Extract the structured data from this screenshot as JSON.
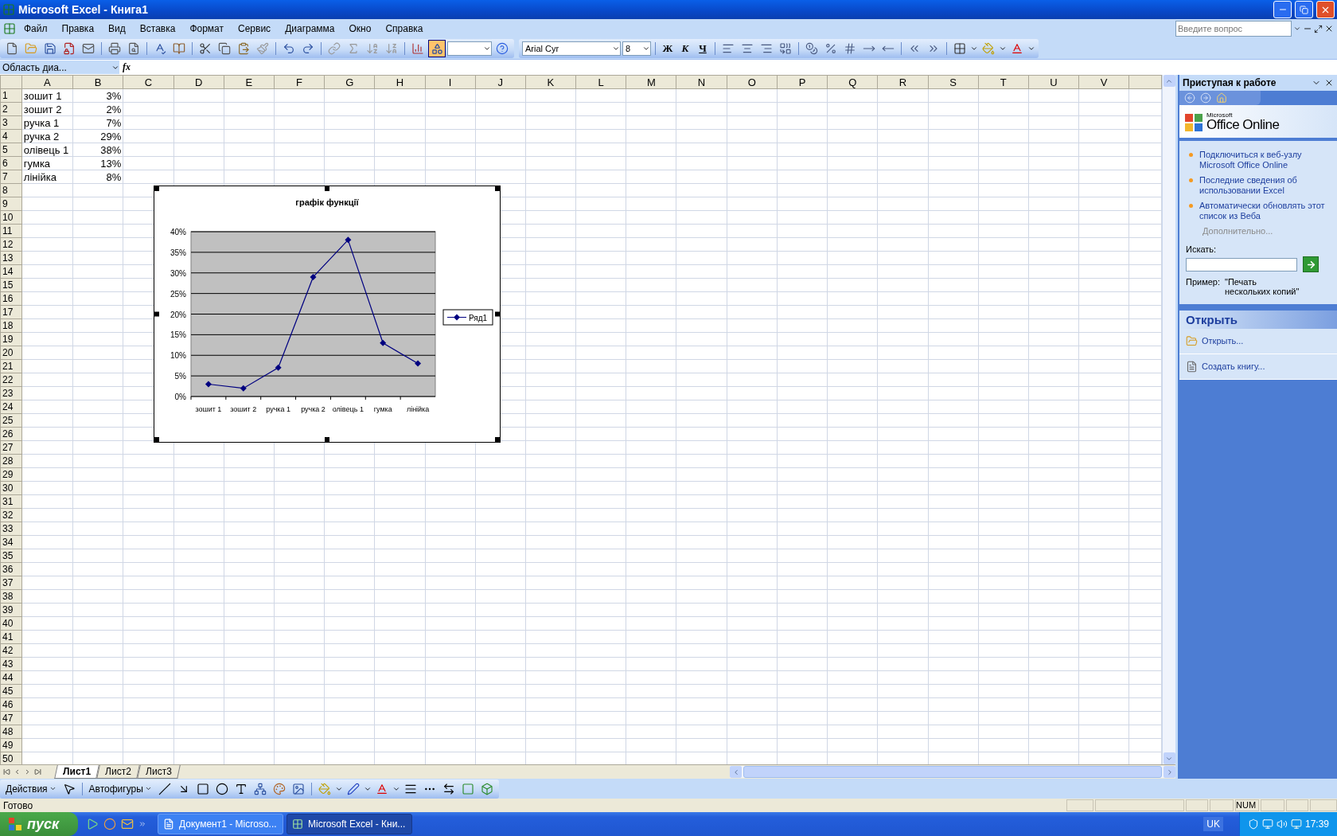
{
  "window": {
    "title": "Microsoft Excel - Книга1"
  },
  "menu": [
    {
      "label": "Файл"
    },
    {
      "label": "Правка"
    },
    {
      "label": "Вид"
    },
    {
      "label": "Вставка"
    },
    {
      "label": "Формат"
    },
    {
      "label": "Сервис"
    },
    {
      "label": "Диаграмма"
    },
    {
      "label": "Окно"
    },
    {
      "label": "Справка"
    }
  ],
  "help_box": {
    "placeholder": "Введите вопрос"
  },
  "standard_toolbar": {
    "drawing_toggle": {
      "on": true
    }
  },
  "format_toolbar": {
    "font": "Arial Cyr",
    "size": "8",
    "style_buttons": [
      {
        "label": "Ж",
        "kind": "bold"
      },
      {
        "label": "К",
        "kind": "italic"
      },
      {
        "label": "Ч",
        "kind": "underline"
      }
    ]
  },
  "formula_bar": {
    "name_box": "Область диа...",
    "function_label": "fx"
  },
  "sheet": {
    "columns": [
      "A",
      "B",
      "C",
      "D",
      "E",
      "F",
      "G",
      "H",
      "I",
      "J",
      "K",
      "L",
      "M",
      "N",
      "O",
      "P",
      "Q",
      "R",
      "S",
      "T",
      "U",
      "V"
    ],
    "row_numbers": [
      "1",
      "2",
      "3",
      "4",
      "5",
      "6",
      "7",
      "8",
      "9",
      "10",
      "11",
      "12",
      "13",
      "14",
      "15",
      "16",
      "17",
      "18",
      "19",
      "20",
      "21",
      "22",
      "23",
      "24",
      "25",
      "26",
      "27",
      "28",
      "29",
      "30",
      "31",
      "32",
      "33",
      "34",
      "35",
      "36",
      "37",
      "38",
      "39",
      "40",
      "41",
      "42",
      "43",
      "44",
      "45",
      "46",
      "47",
      "48",
      "49",
      "50"
    ],
    "rows": [
      {
        "label": "зошит 1",
        "value": "3%"
      },
      {
        "label": "зошит 2",
        "value": "2%"
      },
      {
        "label": "ручка 1",
        "value": "7%"
      },
      {
        "label": "ручка 2",
        "value": "29%"
      },
      {
        "label": "олівець 1",
        "value": "38%"
      },
      {
        "label": "гумка",
        "value": "13%"
      },
      {
        "label": "лінійка",
        "value": "8%"
      }
    ]
  },
  "chart": {
    "chart_data": {
      "type": "line",
      "title": "графік функції",
      "categories": [
        "зошит 1",
        "зошит 2",
        "ручка 1",
        "ручка 2",
        "олівець 1",
        "гумка",
        "лінійка"
      ],
      "series": [
        {
          "name": "Ряд1",
          "color": "#000080",
          "values": [
            0.03,
            0.02,
            0.07,
            0.29,
            0.38,
            0.13,
            0.08
          ]
        }
      ],
      "ylim": [
        0,
        0.4
      ],
      "grid": true,
      "marker": "diamond",
      "yticks": [
        {
          "value": 0,
          "label": "0%"
        },
        {
          "value": 0.05,
          "label": "5%"
        },
        {
          "value": 0.1,
          "label": "10%"
        },
        {
          "value": 0.15,
          "label": "15%"
        },
        {
          "value": 0.2,
          "label": "20%"
        },
        {
          "value": 0.25,
          "label": "25%"
        },
        {
          "value": 0.3,
          "label": "30%"
        },
        {
          "value": 0.35,
          "label": "35%"
        },
        {
          "value": 0.4,
          "label": "40%"
        }
      ]
    }
  },
  "sheet_tabs": [
    {
      "label": "Лист1",
      "selected": true
    },
    {
      "label": "Лист2",
      "selected": false
    },
    {
      "label": "Лист3",
      "selected": false
    }
  ],
  "drawing_toolbar": {
    "actions": "Действия",
    "autoshapes": "Автофигуры"
  },
  "task_pane": {
    "title": "Приступая к работе",
    "logo_small": "Microsoft",
    "logo": "Office Online",
    "links": [
      {
        "text": "Подключиться к веб-узлу Microsoft Office Online"
      },
      {
        "text": "Последние сведения об использовании Excel"
      },
      {
        "text": "Автоматически обновлять этот список из Веба"
      }
    ],
    "more": "Дополнительно...",
    "search_label": "Искать:",
    "example_label": "Пример:",
    "example": "\"Печать нескольких копий\"",
    "section": "Открыть",
    "items": [
      {
        "text": "Открыть...",
        "kind": "open"
      },
      {
        "text": "Создать книгу...",
        "kind": "new"
      }
    ]
  },
  "status_bar": {
    "status": "Готово",
    "indicator": "NUM"
  },
  "taskbar": {
    "start": "пуск",
    "tasks": [
      {
        "label": "Документ1 - Microso...",
        "kind": "word",
        "selected": false
      },
      {
        "label": "Microsoft Excel - Кни...",
        "kind": "excel",
        "selected": true
      }
    ],
    "language": "UK",
    "time": "17:39"
  }
}
